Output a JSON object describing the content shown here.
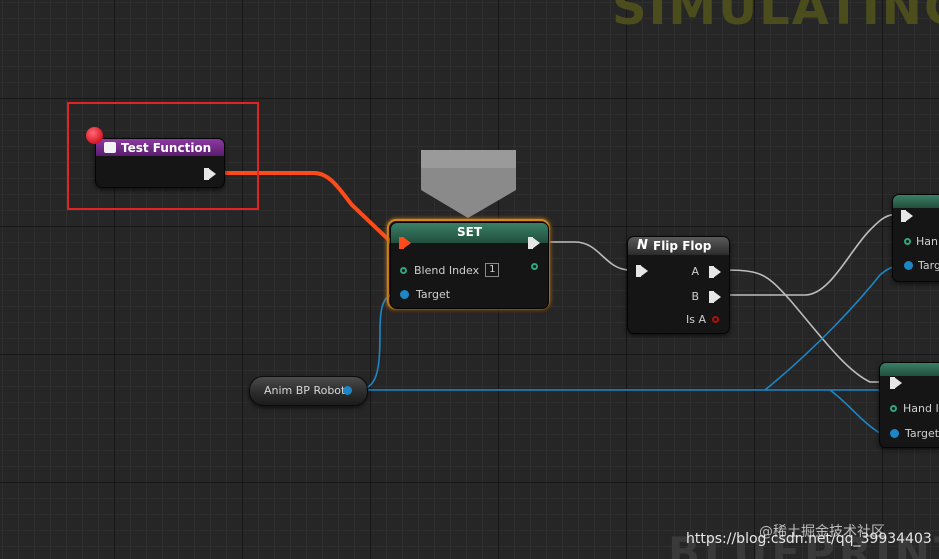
{
  "watermarks": {
    "top": "SIMULATING",
    "bottom": "BLUEPRINT",
    "juejin": "@稀土掘金技术社区",
    "csdn": "https://blog.csdn.net/qq_39934403"
  },
  "colors": {
    "exec_wire": "#cccccc",
    "debug_wire": "#ff4a1a",
    "object_wire": "#1d86c6",
    "function_header": "#7a2a93",
    "set_header": "#2f6e55",
    "selection": "#e08a1c",
    "highlight_box": "#e02424",
    "breakpoint": "#e0202e"
  },
  "nodes": {
    "test_function": {
      "title": "Test Function",
      "icon": "function-icon",
      "breakpoint": "breakpoint-icon"
    },
    "set": {
      "title": "SET",
      "blend_label": "Blend Index",
      "blend_value": "1",
      "target_label": "Target"
    },
    "flip_flop": {
      "title": "Flip Flop",
      "icon": "flipflop-icon",
      "a_label": "A",
      "b_label": "B",
      "is_a_label": "Is A"
    },
    "right_top": {
      "hand_label": "Han",
      "target_label": "Targ"
    },
    "right_bottom": {
      "hand_label": "Hand I",
      "target_label": "Target"
    },
    "anim_var": {
      "label": "Anim BP Robot"
    }
  }
}
